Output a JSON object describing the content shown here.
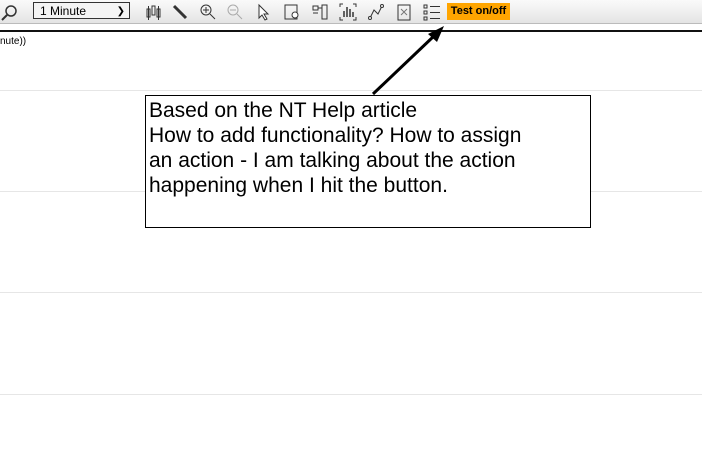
{
  "toolbar": {
    "interval_select": "1 Minute",
    "test_button": "Test on/off"
  },
  "chart": {
    "label": "nute))"
  },
  "callout": {
    "lines": [
      "Based on the NT Help article",
      "How to add functionality? How to assign",
      "an action - I am talking about the action",
      "happening when I hit the button."
    ]
  },
  "colors": {
    "test_button": "#ffa500"
  }
}
